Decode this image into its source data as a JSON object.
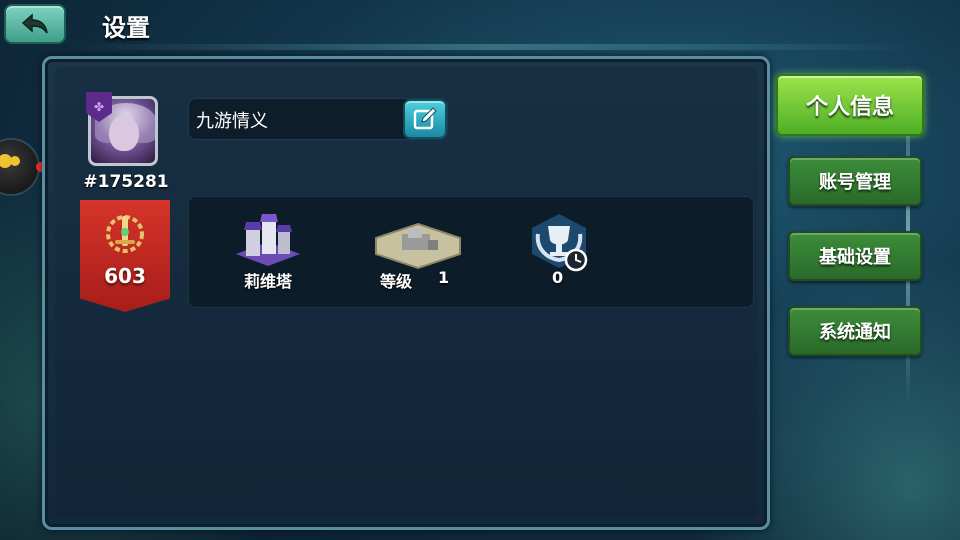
{
  "header": {
    "title": "设置",
    "back_icon": "back-arrow-icon"
  },
  "profile": {
    "player_name": "九游情义",
    "player_id": "#175281",
    "edit_icon": "pencil-edit-icon",
    "avatar": "hero-avatar",
    "rank_value": "603"
  },
  "stats": {
    "tower_label": "莉维塔",
    "level_label": "等级",
    "level_value": "1",
    "trophy_value": "0"
  },
  "tabs": [
    {
      "label": "个人信息",
      "active": true
    },
    {
      "label": "账号管理",
      "active": false
    },
    {
      "label": "基础设置",
      "active": false
    },
    {
      "label": "系统通知",
      "active": false
    }
  ],
  "colors": {
    "tab_active": "#6cc832",
    "tab_inactive": "#347c32",
    "rank_banner": "#c22a22",
    "edit_button": "#2aaac0"
  }
}
